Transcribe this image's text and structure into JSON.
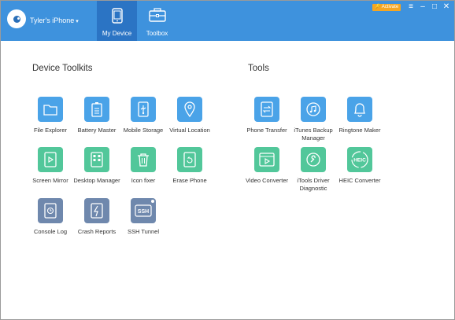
{
  "header": {
    "device_name": "Tyler's iPhone",
    "device_caret": "▾",
    "tabs": [
      {
        "label": "My Device",
        "icon": "phone-icon",
        "active": true
      },
      {
        "label": "Toolbox",
        "icon": "toolbox-icon",
        "active": false
      }
    ],
    "activate_label": "🔑 Activate",
    "window_controls": [
      "≡",
      "–",
      "□",
      "✕"
    ]
  },
  "sections": {
    "device_toolkits": {
      "title": "Device Toolkits",
      "items": [
        {
          "label": "File Explorer",
          "icon": "folder-icon",
          "color": "#4aa3e8"
        },
        {
          "label": "Battery Master",
          "icon": "battery-icon",
          "color": "#4aa3e8"
        },
        {
          "label": "Mobile Storage",
          "icon": "usb-icon",
          "color": "#4aa3e8"
        },
        {
          "label": "Virtual Location",
          "icon": "location-pin-icon",
          "color": "#4aa3e8"
        },
        {
          "label": "Screen Mirror",
          "icon": "screen-mirror-icon",
          "color": "#52c79a"
        },
        {
          "label": "Desktop Manager",
          "icon": "grid-icon",
          "color": "#52c79a"
        },
        {
          "label": "Icon fixer",
          "icon": "trash-icon",
          "color": "#52c79a"
        },
        {
          "label": "Erase Phone",
          "icon": "erase-phone-icon",
          "color": "#52c79a"
        },
        {
          "label": "Console Log",
          "icon": "console-log-icon",
          "color": "#6f88ad"
        },
        {
          "label": "Crash Reports",
          "icon": "crash-report-icon",
          "color": "#6f88ad"
        },
        {
          "label": "SSH Tunnel",
          "icon": "ssh-icon",
          "color": "#6f88ad"
        }
      ]
    },
    "tools": {
      "title": "Tools",
      "items": [
        {
          "label": "Phone Transfer",
          "icon": "phone-transfer-icon",
          "color": "#4aa3e8"
        },
        {
          "label": "iTunes Backup Manager",
          "icon": "music-backup-icon",
          "color": "#4aa3e8"
        },
        {
          "label": "Ringtone Maker",
          "icon": "bell-icon",
          "color": "#4aa3e8"
        },
        {
          "label": "Video Converter",
          "icon": "video-icon",
          "color": "#52c79a"
        },
        {
          "label": "iTools Driver Diagnostic",
          "icon": "wrench-icon",
          "color": "#52c79a"
        },
        {
          "label": "HEIC Converter",
          "icon": "heic-icon",
          "color": "#52c79a"
        }
      ]
    }
  },
  "icon_text": {
    "ssh": "SSH",
    "heic": "HEIC"
  }
}
